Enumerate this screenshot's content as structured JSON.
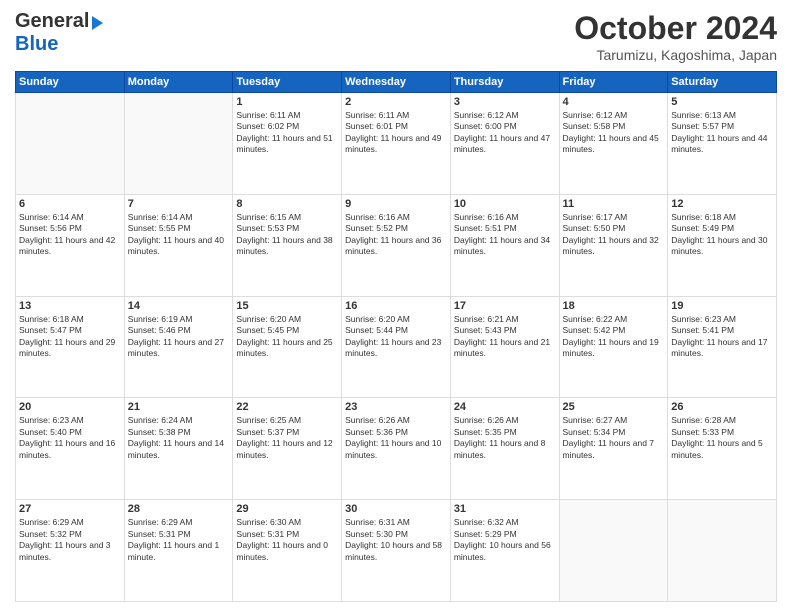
{
  "header": {
    "logo_general": "General",
    "logo_blue": "Blue",
    "month_title": "October 2024",
    "location": "Tarumizu, Kagoshima, Japan"
  },
  "weekdays": [
    "Sunday",
    "Monday",
    "Tuesday",
    "Wednesday",
    "Thursday",
    "Friday",
    "Saturday"
  ],
  "weeks": [
    [
      {
        "day": "",
        "info": ""
      },
      {
        "day": "",
        "info": ""
      },
      {
        "day": "1",
        "info": "Sunrise: 6:11 AM\nSunset: 6:02 PM\nDaylight: 11 hours and 51 minutes."
      },
      {
        "day": "2",
        "info": "Sunrise: 6:11 AM\nSunset: 6:01 PM\nDaylight: 11 hours and 49 minutes."
      },
      {
        "day": "3",
        "info": "Sunrise: 6:12 AM\nSunset: 6:00 PM\nDaylight: 11 hours and 47 minutes."
      },
      {
        "day": "4",
        "info": "Sunrise: 6:12 AM\nSunset: 5:58 PM\nDaylight: 11 hours and 45 minutes."
      },
      {
        "day": "5",
        "info": "Sunrise: 6:13 AM\nSunset: 5:57 PM\nDaylight: 11 hours and 44 minutes."
      }
    ],
    [
      {
        "day": "6",
        "info": "Sunrise: 6:14 AM\nSunset: 5:56 PM\nDaylight: 11 hours and 42 minutes."
      },
      {
        "day": "7",
        "info": "Sunrise: 6:14 AM\nSunset: 5:55 PM\nDaylight: 11 hours and 40 minutes."
      },
      {
        "day": "8",
        "info": "Sunrise: 6:15 AM\nSunset: 5:53 PM\nDaylight: 11 hours and 38 minutes."
      },
      {
        "day": "9",
        "info": "Sunrise: 6:16 AM\nSunset: 5:52 PM\nDaylight: 11 hours and 36 minutes."
      },
      {
        "day": "10",
        "info": "Sunrise: 6:16 AM\nSunset: 5:51 PM\nDaylight: 11 hours and 34 minutes."
      },
      {
        "day": "11",
        "info": "Sunrise: 6:17 AM\nSunset: 5:50 PM\nDaylight: 11 hours and 32 minutes."
      },
      {
        "day": "12",
        "info": "Sunrise: 6:18 AM\nSunset: 5:49 PM\nDaylight: 11 hours and 30 minutes."
      }
    ],
    [
      {
        "day": "13",
        "info": "Sunrise: 6:18 AM\nSunset: 5:47 PM\nDaylight: 11 hours and 29 minutes."
      },
      {
        "day": "14",
        "info": "Sunrise: 6:19 AM\nSunset: 5:46 PM\nDaylight: 11 hours and 27 minutes."
      },
      {
        "day": "15",
        "info": "Sunrise: 6:20 AM\nSunset: 5:45 PM\nDaylight: 11 hours and 25 minutes."
      },
      {
        "day": "16",
        "info": "Sunrise: 6:20 AM\nSunset: 5:44 PM\nDaylight: 11 hours and 23 minutes."
      },
      {
        "day": "17",
        "info": "Sunrise: 6:21 AM\nSunset: 5:43 PM\nDaylight: 11 hours and 21 minutes."
      },
      {
        "day": "18",
        "info": "Sunrise: 6:22 AM\nSunset: 5:42 PM\nDaylight: 11 hours and 19 minutes."
      },
      {
        "day": "19",
        "info": "Sunrise: 6:23 AM\nSunset: 5:41 PM\nDaylight: 11 hours and 17 minutes."
      }
    ],
    [
      {
        "day": "20",
        "info": "Sunrise: 6:23 AM\nSunset: 5:40 PM\nDaylight: 11 hours and 16 minutes."
      },
      {
        "day": "21",
        "info": "Sunrise: 6:24 AM\nSunset: 5:38 PM\nDaylight: 11 hours and 14 minutes."
      },
      {
        "day": "22",
        "info": "Sunrise: 6:25 AM\nSunset: 5:37 PM\nDaylight: 11 hours and 12 minutes."
      },
      {
        "day": "23",
        "info": "Sunrise: 6:26 AM\nSunset: 5:36 PM\nDaylight: 11 hours and 10 minutes."
      },
      {
        "day": "24",
        "info": "Sunrise: 6:26 AM\nSunset: 5:35 PM\nDaylight: 11 hours and 8 minutes."
      },
      {
        "day": "25",
        "info": "Sunrise: 6:27 AM\nSunset: 5:34 PM\nDaylight: 11 hours and 7 minutes."
      },
      {
        "day": "26",
        "info": "Sunrise: 6:28 AM\nSunset: 5:33 PM\nDaylight: 11 hours and 5 minutes."
      }
    ],
    [
      {
        "day": "27",
        "info": "Sunrise: 6:29 AM\nSunset: 5:32 PM\nDaylight: 11 hours and 3 minutes."
      },
      {
        "day": "28",
        "info": "Sunrise: 6:29 AM\nSunset: 5:31 PM\nDaylight: 11 hours and 1 minute."
      },
      {
        "day": "29",
        "info": "Sunrise: 6:30 AM\nSunset: 5:31 PM\nDaylight: 11 hours and 0 minutes."
      },
      {
        "day": "30",
        "info": "Sunrise: 6:31 AM\nSunset: 5:30 PM\nDaylight: 10 hours and 58 minutes."
      },
      {
        "day": "31",
        "info": "Sunrise: 6:32 AM\nSunset: 5:29 PM\nDaylight: 10 hours and 56 minutes."
      },
      {
        "day": "",
        "info": ""
      },
      {
        "day": "",
        "info": ""
      }
    ]
  ]
}
